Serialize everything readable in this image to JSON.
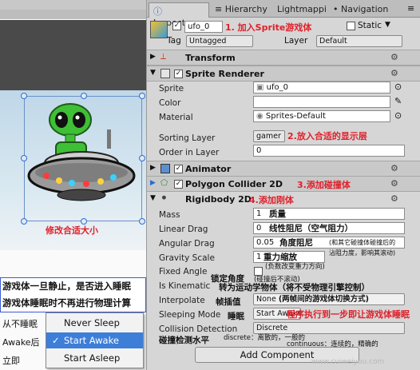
{
  "tabs": {
    "inspector": "Inspector",
    "hierarchy": "Hierarchy",
    "lightmap": "Lightmappi",
    "navigation": "Navigation"
  },
  "object": {
    "name": "ufo_0",
    "static_label": "Static",
    "tag_label": "Tag",
    "tag_value": "Untagged",
    "layer_label": "Layer",
    "layer_value": "Default"
  },
  "components": {
    "transform": "Transform",
    "sprite_renderer": "Sprite Renderer",
    "animator": "Animator",
    "polygon_collider": "Polygon Collider 2D",
    "rigidbody": "Rigidbody 2D",
    "add_component": "Add Component"
  },
  "sprite_renderer": {
    "sprite_label": "Sprite",
    "sprite_value": "ufo_0",
    "color_label": "Color",
    "material_label": "Material",
    "material_value": "Sprites-Default",
    "sorting_layer_label": "Sorting Layer",
    "sorting_layer_value": "gamer",
    "order_label": "Order in Layer",
    "order_value": "0"
  },
  "rigidbody": {
    "mass_label": "Mass",
    "mass_value": "1",
    "linear_drag_label": "Linear Drag",
    "linear_drag_value": "0",
    "angular_drag_label": "Angular Drag",
    "angular_drag_value": "0.05",
    "gravity_label": "Gravity Scale",
    "gravity_value": "1",
    "fixed_angle_label": "Fixed Angle",
    "kinematic_label": "Is Kinematic",
    "interpolate_label": "Interpolate",
    "interpolate_value": "None",
    "sleeping_label": "Sleeping Mode",
    "sleeping_value": "Start Awake",
    "collision_label": "Collision Detection",
    "collision_value": "Discrete"
  },
  "annotations": {
    "a1": "1. 加入Sprite游戏体",
    "a2": "2.放入合适的显示层",
    "a3": "3.添加碰撞体",
    "a4": "4.添加刚体",
    "resize": "修改合适大小",
    "mass": "质量",
    "linear": "线性阻尼（空气阻力）",
    "angular": "角度阻尼",
    "angular_small": "(和其它碰撞体碰撞后的",
    "angular_small2": "沾阻力度，影响其滚动)",
    "gravity": "重力缩放",
    "gravity_small": "(负数改变重力方向)",
    "fixed": "锁定角度",
    "fixed_small": "(碰撞后不滚动)",
    "kinematic": "转为运动学物体（将不受物理引擎控制）",
    "interp": "帧插值",
    "interp_small": "(两帧间的游戏体切换方式)",
    "sleep": "睡眠",
    "sleep_right": "程序执行到一步即让游戏体睡眠",
    "collision": "碰撞检测水平",
    "discrete_note": "discrete：离散的，一般的",
    "continuous_note": "continuous：连续的，精确的",
    "left_note1": "游戏体一旦静止，是否进入睡眠",
    "left_note2": "游戏体睡眠时不再进行物理计算",
    "never": "从不睡眠",
    "awake": "Awake后",
    "at_once": "立即",
    "watermark": "www.cuiweiyou.com"
  },
  "popup": {
    "never": "Never Sleep",
    "awake": "Start Awake",
    "asleep": "Start Asleep"
  }
}
